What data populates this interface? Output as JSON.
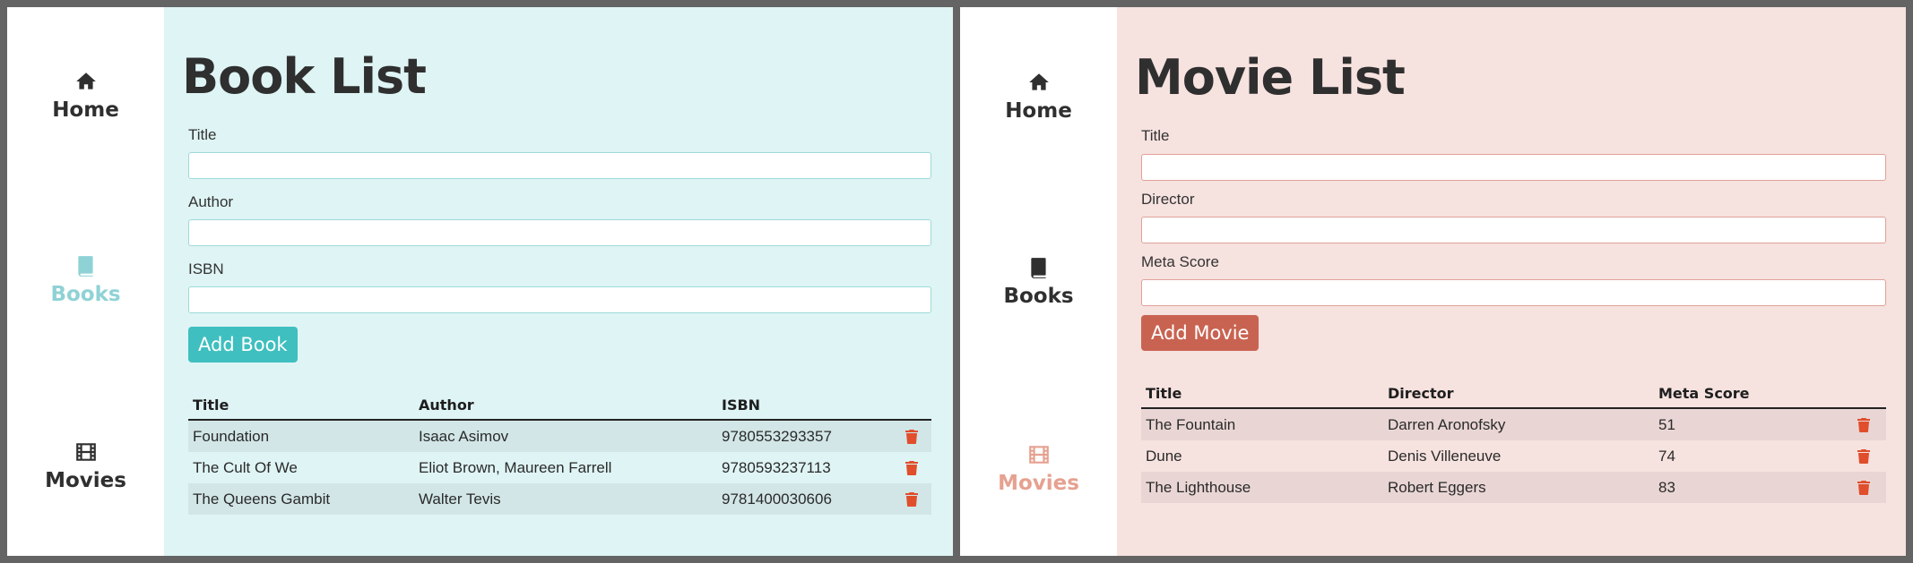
{
  "nav": {
    "home": "Home",
    "books": "Books",
    "movies": "Movies"
  },
  "book_page": {
    "title": "Book List",
    "fields": {
      "title": "Title",
      "author": "Author",
      "isbn": "ISBN"
    },
    "values": {
      "title": "",
      "author": "",
      "isbn": ""
    },
    "add_button": "Add Book",
    "columns": [
      "Title",
      "Author",
      "ISBN"
    ],
    "rows": [
      [
        "Foundation",
        "Isaac Asimov",
        "9780553293357"
      ],
      [
        "The Cult Of We",
        "Eliot Brown, Maureen Farrell",
        "9780593237113"
      ],
      [
        "The Queens Gambit",
        "Walter Tevis",
        "9781400030606"
      ]
    ],
    "active_nav": "books",
    "accent": "#3fbfbf"
  },
  "movie_page": {
    "title": "Movie List",
    "fields": {
      "title": "Title",
      "director": "Director",
      "meta_score": "Meta Score"
    },
    "values": {
      "title": "",
      "director": "",
      "meta_score": ""
    },
    "add_button": "Add Movie",
    "columns": [
      "Title",
      "Director",
      "Meta Score"
    ],
    "rows": [
      [
        "The Fountain",
        "Darren Aronofsky",
        "51"
      ],
      [
        "Dune",
        "Denis Villeneuve",
        "74"
      ],
      [
        "The Lighthouse",
        "Robert Eggers",
        "83"
      ]
    ],
    "active_nav": "movies",
    "accent": "#c96351"
  },
  "icons": {
    "home": "home-icon",
    "books": "book-icon",
    "movies": "film-icon",
    "delete": "trash-icon"
  },
  "colors": {
    "book_bg": "#dff4f4",
    "movie_bg": "#f6e2df",
    "book_active": "#8fd2d6",
    "movie_active": "#e6a190",
    "trash": "#e04e2c"
  }
}
